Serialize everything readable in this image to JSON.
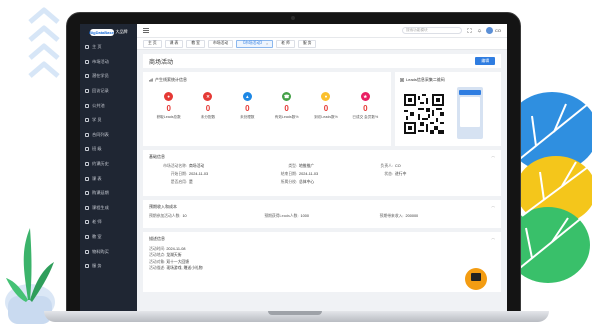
{
  "app": {
    "logo_badge": "BigDataBase",
    "logo_text": "大品牌"
  },
  "sidebar": {
    "items": [
      {
        "label": "主 页",
        "icon": "home-icon"
      },
      {
        "label": "市场活动",
        "icon": "flag-icon"
      },
      {
        "label": "潜在学员",
        "icon": "users-icon"
      },
      {
        "label": "回访记录",
        "icon": "phone-icon"
      },
      {
        "label": "公共池",
        "icon": "pool-icon"
      },
      {
        "label": "学 员",
        "icon": "student-icon"
      },
      {
        "label": "合同列表",
        "icon": "contract-icon"
      },
      {
        "label": "班 级",
        "icon": "class-icon"
      },
      {
        "label": "约课历史",
        "icon": "history-icon"
      },
      {
        "label": "课 表",
        "icon": "calendar-icon"
      },
      {
        "label": "购课延期",
        "icon": "clock-icon"
      },
      {
        "label": "课程生成",
        "icon": "course-icon"
      },
      {
        "label": "老 师",
        "icon": "teacher-icon"
      },
      {
        "label": "教 室",
        "icon": "room-icon"
      },
      {
        "label": "物料购买",
        "icon": "cart-icon"
      },
      {
        "label": "服 务",
        "icon": "service-icon"
      }
    ]
  },
  "topbar": {
    "search_placeholder": "搜索功能模块",
    "username": "CO"
  },
  "tabs": [
    {
      "label": "主 页",
      "active": false
    },
    {
      "label": "课 表",
      "active": false
    },
    {
      "label": "教 室",
      "active": false
    },
    {
      "label": "市场活动",
      "active": false
    },
    {
      "label": "【市场活动】",
      "active": true
    },
    {
      "label": "老 师",
      "active": false
    },
    {
      "label": "服 务",
      "active": false
    }
  ],
  "page": {
    "title": "商场活动",
    "edit_button": "编辑"
  },
  "stats_card": {
    "title": "产生线索统计信息",
    "stats": [
      {
        "value": "0",
        "label": "获取Leads总数",
        "color": "#e53935",
        "icon": "person-icon"
      },
      {
        "value": "0",
        "label": "未分配数",
        "color": "#e53935",
        "icon": "unassigned-icon"
      },
      {
        "value": "0",
        "label": "未处理数",
        "color": "#1e88e5",
        "icon": "flask-icon"
      },
      {
        "value": "0",
        "label": "有效Leads数%",
        "color": "#43a047",
        "icon": "call-icon"
      },
      {
        "value": "0",
        "label": "到访Leads数%",
        "color": "#fbc02d",
        "icon": "paw-icon"
      },
      {
        "value": "0",
        "label": "已成交 会员数%",
        "color": "#e91e63",
        "icon": "badge-icon"
      }
    ]
  },
  "qr_card": {
    "title": "Leads信息采集二维码"
  },
  "basic": {
    "title": "基础信息",
    "fields": [
      {
        "k": "市场活动名称:",
        "v": "商场活动"
      },
      {
        "k": "类型:",
        "v": "地推推广"
      },
      {
        "k": "负责人:",
        "v": "CO"
      },
      {
        "k": "开始日期:",
        "v": "2024-11-03"
      },
      {
        "k": "结束日期:",
        "v": "2024-11-03"
      },
      {
        "k": "状态:",
        "v": "进行中"
      },
      {
        "k": "是否启用:",
        "v": "是"
      },
      {
        "k": "所属分校:",
        "v": "总体中心"
      },
      {
        "k": "",
        "v": ""
      }
    ]
  },
  "budget": {
    "title": "预期收入和成本",
    "fields": [
      {
        "k": "预期参加活动人数:",
        "v": "10"
      },
      {
        "k": "预期获得Leads人数:",
        "v": "1000"
      },
      {
        "k": "预期带来收入:",
        "v": "200000"
      }
    ]
  },
  "desc": {
    "title": "描述信息",
    "lines": [
      {
        "k": "活动时间:",
        "v": "2024-11-08"
      },
      {
        "k": "活动地点:",
        "v": "龙湖天街"
      },
      {
        "k": "活动对象:",
        "v": "双十一大回馈"
      },
      {
        "k": "活动描述:",
        "v": "现场游戏, 赠送小礼物"
      }
    ]
  }
}
